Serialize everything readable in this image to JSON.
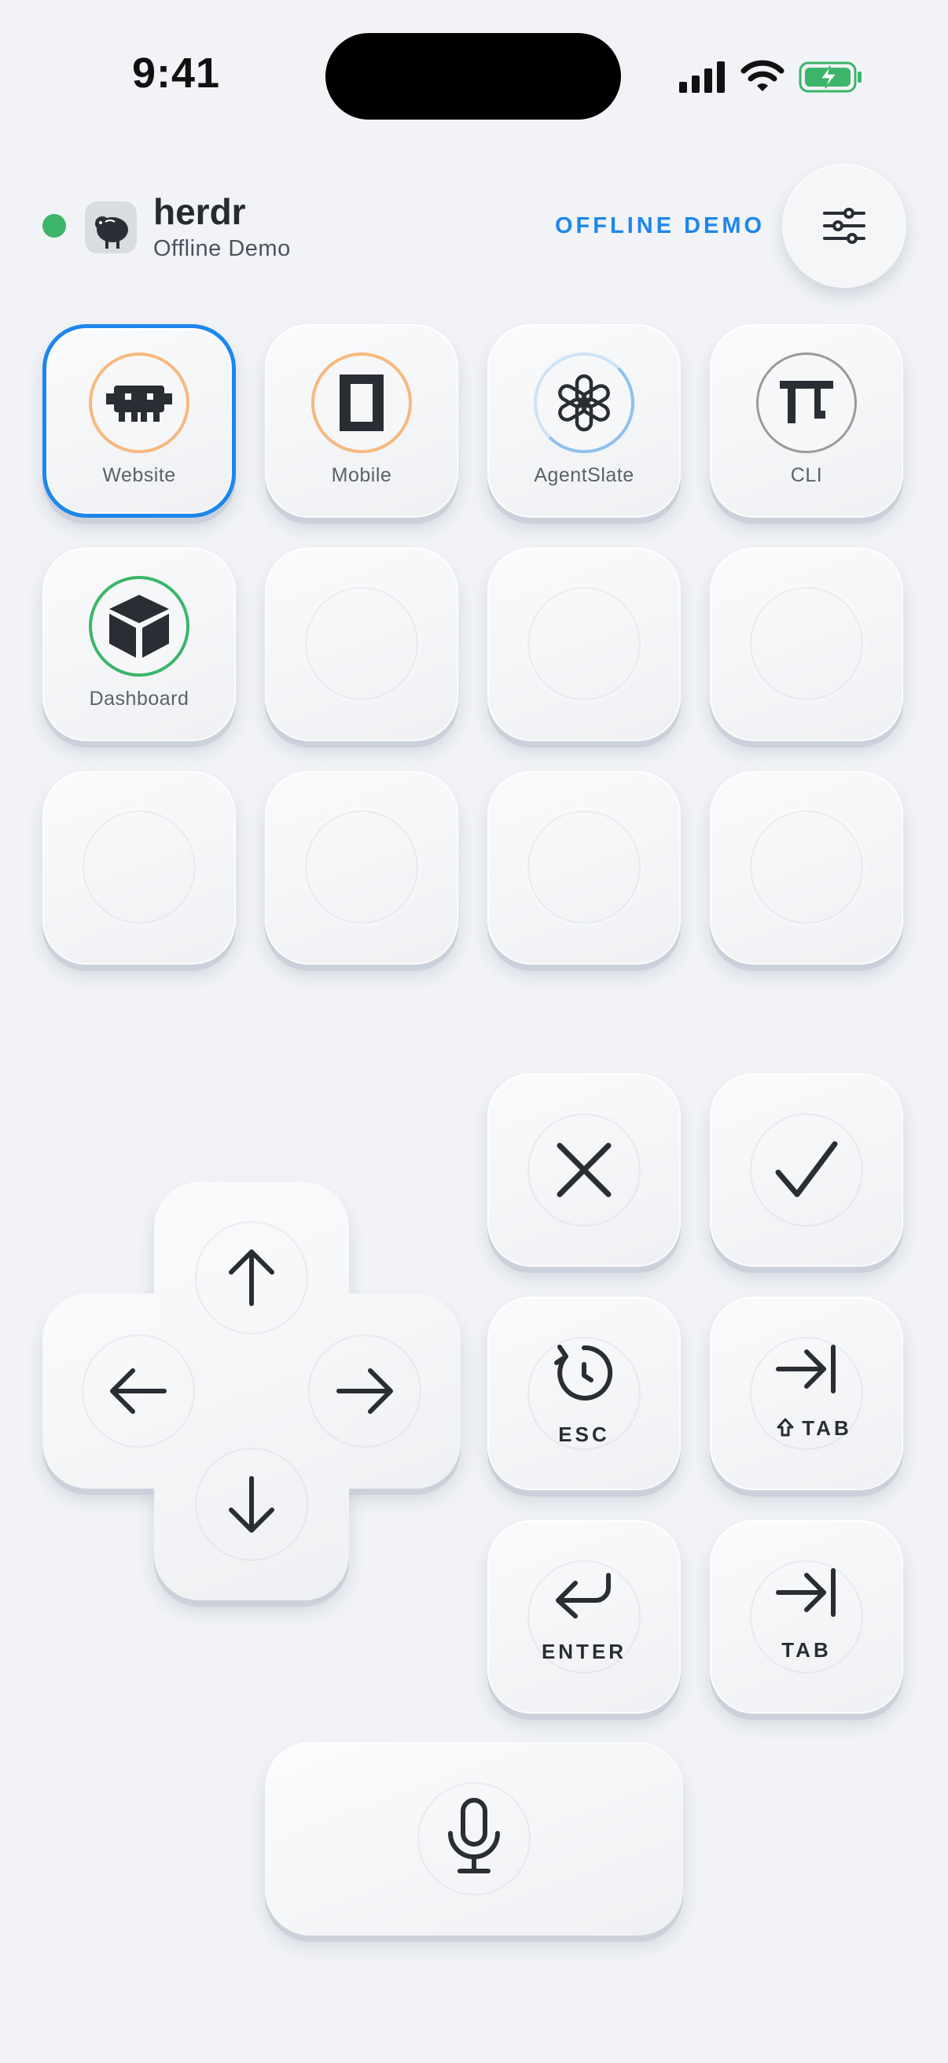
{
  "status_bar": {
    "time": "9:41"
  },
  "header": {
    "app_name": "herdr",
    "subtitle": "Offline Demo",
    "mode_label": "OFFLINE DEMO",
    "status_color": "#3cb56a",
    "accent_color": "#1e86ec"
  },
  "workspaces": [
    {
      "label": "Website",
      "icon": "invader-icon",
      "ring_color": "#f6b97d",
      "selected": true
    },
    {
      "label": "Mobile",
      "icon": "phone-frame-icon",
      "ring_color": "#f6b97d",
      "selected": false
    },
    {
      "label": "AgentSlate",
      "icon": "openai-knot-icon",
      "ring_color": "#9cc8f0",
      "selected": false
    },
    {
      "label": "CLI",
      "icon": "terminal-t-icon",
      "ring_color": "#9a9a9a",
      "selected": false
    },
    {
      "label": "Dashboard",
      "icon": "cube-icon",
      "ring_color": "#3cb56a",
      "selected": false
    }
  ],
  "controls": {
    "cancel": {
      "icon": "x-icon"
    },
    "confirm": {
      "icon": "check-icon"
    },
    "esc": {
      "label": "ESC",
      "icon": "undo-circle-icon"
    },
    "shift_tab": {
      "label": "TAB",
      "icon": "tab-arrow-icon"
    },
    "enter": {
      "label": "ENTER",
      "icon": "return-arrow-icon"
    },
    "tab": {
      "label": "TAB",
      "icon": "tab-arrow-icon"
    },
    "mic": {
      "icon": "microphone-icon"
    }
  }
}
